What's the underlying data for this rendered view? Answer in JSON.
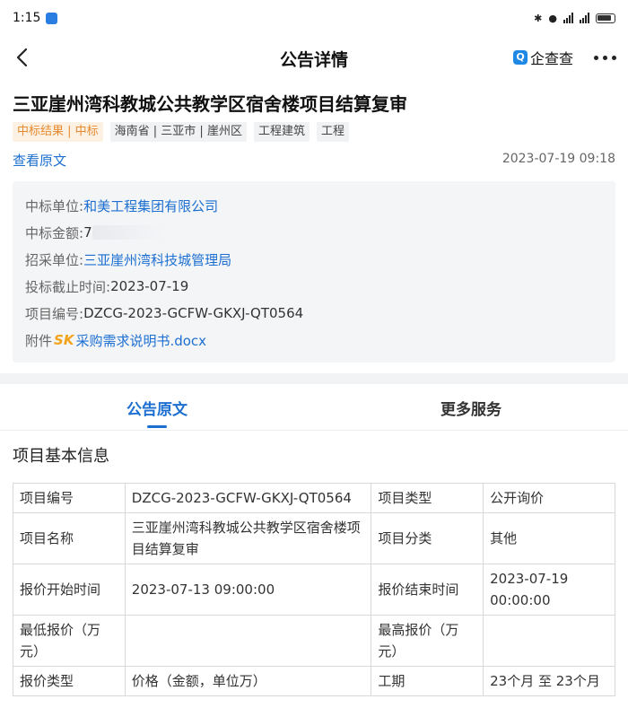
{
  "status_bar": {
    "time": "1:15"
  },
  "nav": {
    "title": "公告详情",
    "qcc_label": "企查查"
  },
  "header": {
    "title": "三亚崖州湾科教城公共教学区宿舍楼项目结算复审",
    "tags": [
      "中标结果 | 中标",
      "海南省 | 三亚市 | 崖州区",
      "工程建筑",
      "工程"
    ],
    "view_original": "查看原文",
    "publish_time": "2023-07-19 09:18"
  },
  "info": {
    "winner_label": "中标单位:",
    "winner": "和美工程集团有限公司",
    "amount_label": "中标金额:",
    "amount_visible": "7",
    "buyer_label": "招采单位:",
    "buyer": "三亚崖州湾科技城管理局",
    "deadline_label": "投标截止时间:",
    "deadline": "2023-07-19",
    "project_no_label": "项目编号:",
    "project_no": "DZCG-2023-GCFW-GKXJ-QT0564",
    "attachment_label": "附件",
    "attachment_badge": "SK",
    "attachment_file": "采购需求说明书.docx"
  },
  "tabs": {
    "active": "公告原文",
    "other": "更多服务"
  },
  "content": {
    "section_title": "项目基本信息",
    "rows": [
      [
        "项目编号",
        "DZCG-2023-GCFW-GKXJ-QT0564",
        "项目类型",
        "公开询价"
      ],
      [
        "项目名称",
        "三亚崖州湾科教城公共教学区宿舍楼项目结算复审",
        "项目分类",
        "其他"
      ],
      [
        "报价开始时间",
        "2023-07-13 09:00:00",
        "报价结束时间",
        "2023-07-19 00:00:00"
      ],
      [
        "最低报价（万元）",
        "",
        "最高报价（万元）",
        ""
      ],
      [
        "报价类型",
        "价格（金额，单位万）",
        "工期",
        "23个月 至 23个月"
      ]
    ]
  }
}
